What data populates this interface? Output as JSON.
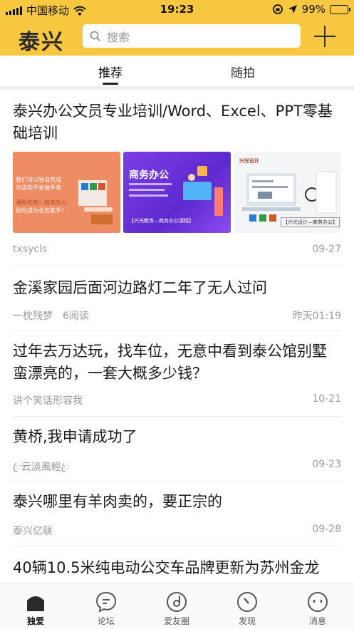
{
  "status_bar": {
    "carrier": "中国移动",
    "time": "19:23",
    "battery": "99%",
    "battery_level": 0.99
  },
  "header": {
    "logo": "泰兴",
    "search_placeholder": "搜索"
  },
  "tabs": [
    {
      "label": "推荐",
      "active": true
    },
    {
      "label": "随拍",
      "active": false
    }
  ],
  "feed": [
    {
      "title": "泰兴办公文员专业培训/Word、Excel、PPT零基础培训",
      "author": "txsycls",
      "date": "09-27",
      "images": [
        {
          "lines": [
            "我们可以独自完成",
            "为这些不会做手表",
            "课程名称：商务办公",
            "助你成为业务能手！"
          ]
        },
        {
          "heading": "商务办公",
          "caption": "【兴光教育—商务办公课程】"
        },
        {
          "brand": "兴光设计",
          "caption": "【兴光设计—商务办公】"
        }
      ]
    },
    {
      "title": "金溪家园后面河边路灯二年了无人过问",
      "author": "一枕残梦",
      "reads": "6阅读",
      "date": "昨天01:19"
    },
    {
      "title": "过年去万达玩，找车位，无意中看到泰公馆别墅蛮漂亮的，一套大概多少钱？",
      "author": "讲个笑话形容我",
      "date": "10-21"
    },
    {
      "title": "黄桥,我申请成功了",
      "author": "ꦿ云淡風輕ꦿ",
      "date": "09-23"
    },
    {
      "title": "泰兴哪里有羊肉卖的，要正宗的",
      "author": "泰兴亿联",
      "date": "09-28"
    },
    {
      "title": "40辆10.5米纯电动公交车品牌更新为苏州金龙"
    }
  ],
  "tabbar": [
    {
      "label": "独爱",
      "icon": "home-icon",
      "active": true
    },
    {
      "label": "论坛",
      "icon": "chat-bubble-icon",
      "active": false
    },
    {
      "label": "爱友圈",
      "icon": "disc-icon",
      "active": false
    },
    {
      "label": "发现",
      "icon": "compass-icon",
      "active": false
    },
    {
      "label": "消息",
      "icon": "face-icon",
      "active": false
    }
  ],
  "colors": {
    "brand_yellow": "#f7c83f",
    "text_dark": "#1a1a1a",
    "text_meta": "#9a9a9a"
  }
}
